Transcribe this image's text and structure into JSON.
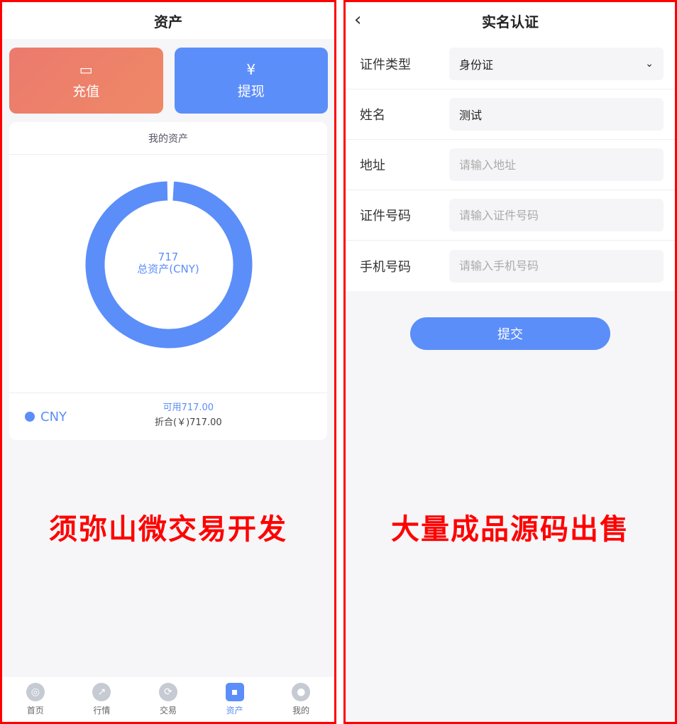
{
  "left": {
    "title": "资产",
    "recharge": "充值",
    "withdraw": "提现",
    "my_assets": "我的资产",
    "total_value": "717",
    "total_label": "总资产(CNY)",
    "chart_data": {
      "type": "pie",
      "donut": true,
      "categories": [
        "CNY"
      ],
      "values": [
        717
      ]
    },
    "currency": "CNY",
    "available": "可用717.00",
    "converted": "折合(￥)717.00",
    "promo": "须弥山微交易开发",
    "tabs": [
      {
        "label": "首页",
        "icon": "home-icon"
      },
      {
        "label": "行情",
        "icon": "trend-icon"
      },
      {
        "label": "交易",
        "icon": "exchange-icon"
      },
      {
        "label": "资产",
        "icon": "wallet-icon",
        "active": true
      },
      {
        "label": "我的",
        "icon": "user-icon"
      }
    ]
  },
  "right": {
    "title": "实名认证",
    "fields": [
      {
        "label": "证件类型",
        "value": "身份证"
      },
      {
        "label": "姓名",
        "value": "测试"
      },
      {
        "label": "地址",
        "placeholder": "请输入地址"
      },
      {
        "label": "证件号码",
        "placeholder": "请输入证件号码"
      },
      {
        "label": "手机号码",
        "placeholder": "请输入手机号码"
      }
    ],
    "submit": "提交",
    "promo": "大量成品源码出售"
  },
  "colors": {
    "accent": "#5b8ef8",
    "recharge": "#ec7a6e",
    "border": "#ff0000"
  }
}
